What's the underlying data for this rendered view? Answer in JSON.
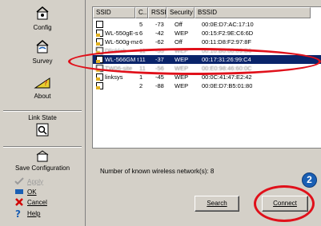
{
  "sidebar": {
    "config_label": "Config",
    "survey_label": "Survey",
    "about_label": "About",
    "link_state_label": "Link State",
    "save_config_label": "Save Configuration",
    "apply_label": "Apply",
    "ok_label": "OK",
    "cancel_label": "Cancel",
    "help_label": "Help"
  },
  "table": {
    "columns": [
      "SSID",
      "C...",
      "RSSI",
      "Security",
      "BSSID"
    ],
    "rows": [
      {
        "ssid": "",
        "ch": "5",
        "rssi": "-73",
        "security": "Off",
        "bssid": "00:0E:D7:AC:17:10"
      },
      {
        "ssid": "WL-550gE-staff",
        "ch": "6",
        "rssi": "-42",
        "security": "WEP",
        "bssid": "00:15:F2:9E:C6:6D"
      },
      {
        "ssid": "WL-500g-man...",
        "ch": "6",
        "rssi": "-62",
        "security": "Off",
        "bssid": "00:11:D8:F2:97:8F"
      },
      {
        "ssid": "Dlinklab",
        "ch": "11",
        "rssi": "-55",
        "security": "WEP",
        "bssid": "00:10:B0:00:09:B6"
      },
      {
        "ssid": "WL-566GM te...",
        "ch": "11",
        "rssi": "-37",
        "security": "WEP",
        "bssid": "00:17:31:26:99:C4"
      },
      {
        "ssid": "TW06-site",
        "ch": "11",
        "rssi": "-56",
        "security": "WEP",
        "bssid": "00:E0:98:46:60:0C"
      },
      {
        "ssid": "linksys",
        "ch": "1",
        "rssi": "-45",
        "security": "WEP",
        "bssid": "00:0C:41:47:E2:42"
      },
      {
        "ssid": "",
        "ch": "2",
        "rssi": "-88",
        "security": "WEP",
        "bssid": "00:0E:D7:B5:01:80"
      }
    ]
  },
  "count_text": "Number of known wireless network(s): 8",
  "buttons": {
    "search": "Search",
    "connect": "Connect"
  },
  "step_badge": "2",
  "colors": {
    "highlight": "#0a246a",
    "annotation": "#e0101a",
    "badge": "#1a5fb4"
  }
}
